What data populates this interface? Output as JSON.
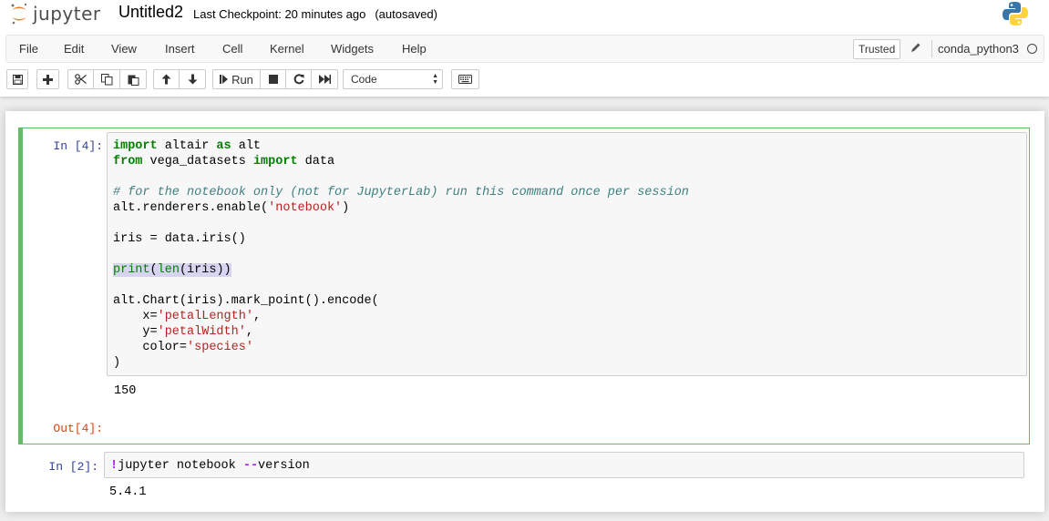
{
  "header": {
    "logo_text": "jupyter",
    "notebook_title": "Untitled2",
    "checkpoint_text": "Last Checkpoint: 20 minutes ago",
    "autosave_text": "(autosaved)"
  },
  "menubar": {
    "items": [
      "File",
      "Edit",
      "View",
      "Insert",
      "Cell",
      "Kernel",
      "Widgets",
      "Help"
    ],
    "trusted_label": "Trusted",
    "kernel_name": "conda_python3"
  },
  "toolbar": {
    "run_label": "Run",
    "cell_type": "Code"
  },
  "cells": [
    {
      "in_prompt": "In [4]:",
      "code_lines": [
        "import altair as alt",
        "from vega_datasets import data",
        "",
        "# for the notebook only (not for JupyterLab) run this command once per session",
        "alt.renderers.enable('notebook')",
        "",
        "iris = data.iris()",
        "",
        "print(len(iris))",
        "",
        "alt.Chart(iris).mark_point().encode(",
        "    x='petalLength',",
        "    y='petalWidth',",
        "    color='species'",
        ")"
      ],
      "stdout": "150",
      "out_prompt": "Out[4]:"
    },
    {
      "in_prompt": "In [2]:",
      "code_lines": [
        "!jupyter notebook --version"
      ],
      "stdout": "5.4.1"
    }
  ],
  "colors": {
    "selected_cell_border": "#66bb6a",
    "in_prompt": "#303f9f",
    "out_prompt": "#d84315",
    "logo_orange": "#f37726"
  }
}
